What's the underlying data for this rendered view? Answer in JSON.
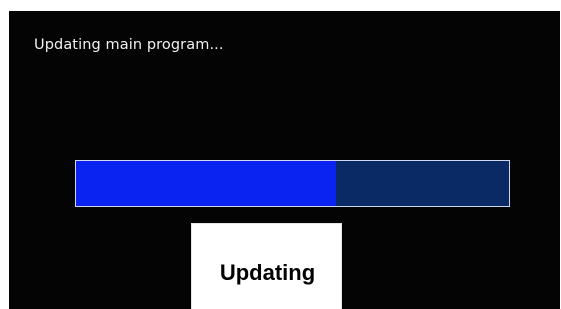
{
  "status": {
    "message": "Updating main program..."
  },
  "progress": {
    "value_fraction": 0.6,
    "fill_color": "#0a23f0",
    "track_color": "#0a2a66"
  },
  "caption": {
    "label": "Updating"
  },
  "colors": {
    "screen_background": "#040404",
    "text": "#f2f2f2"
  }
}
